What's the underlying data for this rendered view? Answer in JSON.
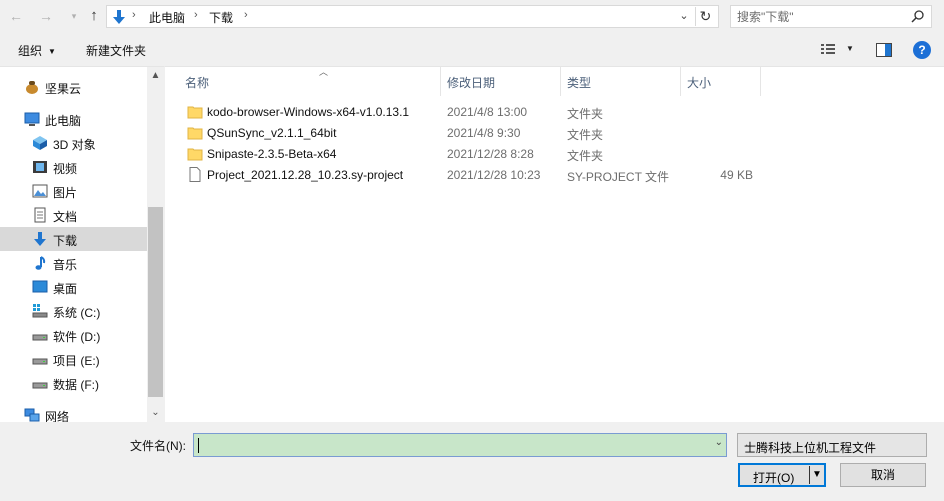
{
  "address": {
    "crumbs": [
      "此电脑",
      "下载"
    ],
    "search_placeholder": "搜索\"下载\""
  },
  "toolbar": {
    "organize_label": "组织",
    "new_folder_label": "新建文件夹"
  },
  "sidebar": {
    "items": [
      {
        "label": "坚果云",
        "icon": "nutstore-icon"
      },
      {
        "label": "此电脑",
        "icon": "computer-icon"
      },
      {
        "label": "3D 对象",
        "icon": "3d-objects-icon"
      },
      {
        "label": "视频",
        "icon": "video-icon"
      },
      {
        "label": "图片",
        "icon": "pictures-icon"
      },
      {
        "label": "文档",
        "icon": "document-icon"
      },
      {
        "label": "下载",
        "icon": "download-icon"
      },
      {
        "label": "音乐",
        "icon": "music-icon"
      },
      {
        "label": "桌面",
        "icon": "desktop-icon"
      },
      {
        "label": "系统 (C:)",
        "icon": "system-drive-icon"
      },
      {
        "label": "软件 (D:)",
        "icon": "drive-icon"
      },
      {
        "label": "项目 (E:)",
        "icon": "drive-icon"
      },
      {
        "label": "数据 (F:)",
        "icon": "drive-icon"
      },
      {
        "label": "网络",
        "icon": "network-icon"
      }
    ]
  },
  "columns": {
    "name": "名称",
    "date": "修改日期",
    "type": "类型",
    "size": "大小"
  },
  "files": [
    {
      "name": "kodo-browser-Windows-x64-v1.0.13.1",
      "date": "2021/4/8 13:00",
      "type": "文件夹",
      "size": "",
      "icon": "folder-icon"
    },
    {
      "name": "QSunSync_v2.1.1_64bit",
      "date": "2021/4/8 9:30",
      "type": "文件夹",
      "size": "",
      "icon": "folder-icon"
    },
    {
      "name": "Snipaste-2.3.5-Beta-x64",
      "date": "2021/12/28 8:28",
      "type": "文件夹",
      "size": "",
      "icon": "folder-icon"
    },
    {
      "name": "Project_2021.12.28_10.23.sy-project",
      "date": "2021/12/28 10:23",
      "type": "SY-PROJECT 文件",
      "size": "49 KB",
      "icon": "file-icon"
    }
  ],
  "bottom": {
    "filename_label": "文件名(N):",
    "filename_value": "",
    "filetype_value": "士腾科技上位机工程文件",
    "open_label": "打开(O)",
    "cancel_label": "取消"
  },
  "colors": {
    "accent": "#0078d7",
    "selected_nav": "#d9d9d9",
    "filename_bg": "#c8e6c9",
    "folder": "#ffd867"
  }
}
